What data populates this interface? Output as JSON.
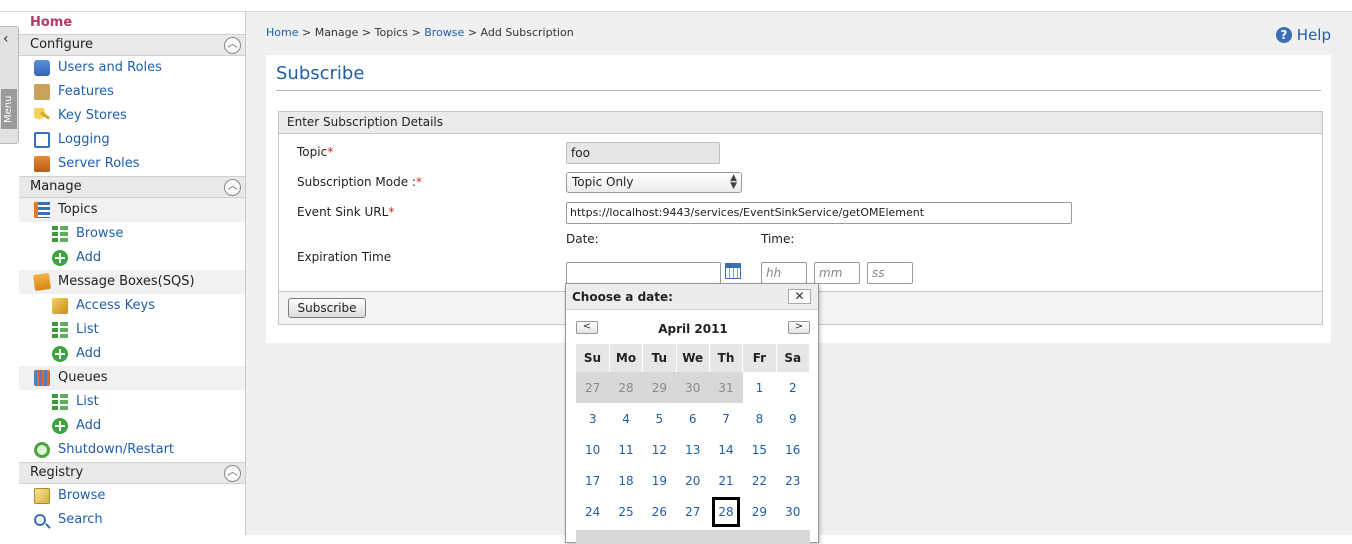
{
  "sidebar": {
    "home": "Home",
    "configure": {
      "title": "Configure",
      "items": [
        {
          "label": "Users and Roles",
          "icon": "users-icon"
        },
        {
          "label": "Features",
          "icon": "puzzle-icon"
        },
        {
          "label": "Key Stores",
          "icon": "key-icon"
        },
        {
          "label": "Logging",
          "icon": "log-icon"
        },
        {
          "label": "Server Roles",
          "icon": "server-icon"
        }
      ]
    },
    "manage": {
      "title": "Manage",
      "topics": {
        "label": "Topics",
        "browse": "Browse",
        "add": "Add"
      },
      "message_boxes": {
        "label": "Message Boxes(SQS)",
        "access_keys": "Access Keys",
        "list": "List",
        "add": "Add"
      },
      "queues": {
        "label": "Queues",
        "list": "List",
        "add": "Add"
      },
      "shutdown": "Shutdown/Restart"
    },
    "registry": {
      "title": "Registry",
      "browse": "Browse",
      "search": "Search"
    },
    "menu_tab": "Menu"
  },
  "breadcrumb": {
    "home": "Home",
    "manage": "Manage",
    "topics": "Topics",
    "browse": "Browse",
    "current": "Add Subscription",
    "sep": ">"
  },
  "help": "Help",
  "page": {
    "title": "Subscribe"
  },
  "form": {
    "header": "Enter Subscription Details",
    "topic_label": "Topic",
    "topic_value": "foo",
    "mode_label": "Subscription Mode :",
    "mode_value": "Topic Only",
    "url_label": "Event Sink URL",
    "url_value": "https://localhost:9443/services/EventSinkService/getOMElement",
    "expiration_label": "Expiration Time",
    "date_label": "Date:",
    "time_label": "Time:",
    "hh_placeholder": "hh",
    "mm_placeholder": "mm",
    "ss_placeholder": "ss",
    "required_mark": "*",
    "submit": "Subscribe"
  },
  "datepicker": {
    "title": "Choose a date:",
    "close": "✕",
    "prev": "<",
    "next": ">",
    "month": "April 2011",
    "weekdays": [
      "Su",
      "Mo",
      "Tu",
      "We",
      "Th",
      "Fr",
      "Sa"
    ],
    "weeks": [
      [
        "27",
        "28",
        "29",
        "30",
        "31",
        "1",
        "2"
      ],
      [
        "3",
        "4",
        "5",
        "6",
        "7",
        "8",
        "9"
      ],
      [
        "10",
        "11",
        "12",
        "13",
        "14",
        "15",
        "16"
      ],
      [
        "17",
        "18",
        "19",
        "20",
        "21",
        "22",
        "23"
      ],
      [
        "24",
        "25",
        "26",
        "27",
        "28",
        "29",
        "30"
      ]
    ],
    "today": "28"
  },
  "colors": {
    "link": "#1f5fa8",
    "home": "#b03a6e",
    "required": "#d92020"
  }
}
